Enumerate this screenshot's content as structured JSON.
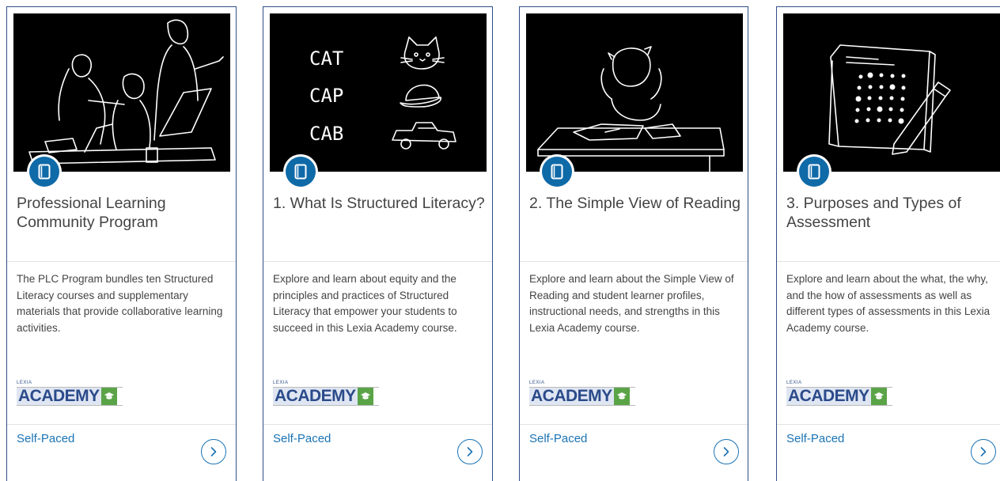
{
  "cards": [
    {
      "title": "Professional Learning Community Program",
      "description": "The PLC Program bundles ten Structured Literacy courses and supplementary materials that provide collaborative learning activities.",
      "logo_small": "LEXIA",
      "logo_text": "ACADEMY",
      "pace": "Self-Paced",
      "image_icon": "team-meeting-illustration"
    },
    {
      "title": "1. What Is Structured Literacy?",
      "description": "Explore and learn about equity and the principles and practices of Structured Literacy that empower your students to succeed in this Lexia Academy course.",
      "logo_small": "LEXIA",
      "logo_text": "ACADEMY",
      "pace": "Self-Paced",
      "image_words": [
        "CAT",
        "CAP",
        "CAB"
      ]
    },
    {
      "title": "2. The Simple View of Reading",
      "description": "Explore and learn about the Simple View of Reading and student learner profiles, instructional needs, and strengths in this Lexia Academy course.",
      "logo_small": "LEXIA",
      "logo_text": "ACADEMY",
      "pace": "Self-Paced",
      "image_icon": "frustrated-student-illustration"
    },
    {
      "title": "3. Purposes and Types of Assessment",
      "description": "Explore and learn about the what, the why, and the how of assessments as well as different types of assessments in this Lexia Academy course.",
      "logo_small": "LEXIA",
      "logo_text": "ACADEMY",
      "pace": "Self-Paced",
      "image_icon": "test-sheet-pencil-illustration"
    }
  ],
  "colors": {
    "border": "#2e4f86",
    "accent": "#1a73b4",
    "badge": "#0f6aa8",
    "logo_green": "#5aa447"
  }
}
